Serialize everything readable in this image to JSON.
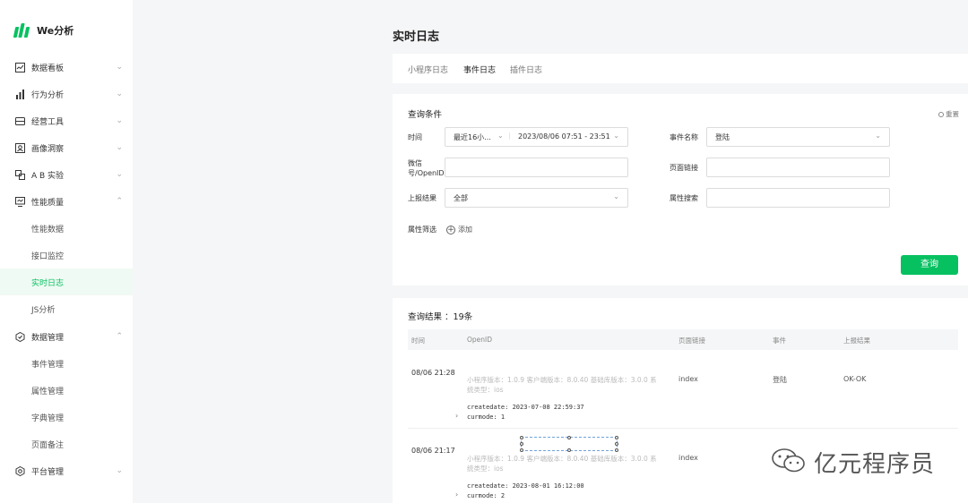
{
  "app": {
    "name": "We分析"
  },
  "sidebar": {
    "items": [
      {
        "label": "数据看板",
        "icon": "chart-line-icon",
        "chevron": "⌄"
      },
      {
        "label": "行为分析",
        "icon": "bar-chart-icon",
        "chevron": "⌄"
      },
      {
        "label": "经营工具",
        "icon": "toolbox-icon",
        "chevron": "⌄"
      },
      {
        "label": "画像洞察",
        "icon": "portrait-icon",
        "chevron": "⌄"
      },
      {
        "label": "A B 实验",
        "icon": "ab-test-icon",
        "chevron": "⌄"
      },
      {
        "label": "性能质量",
        "icon": "monitor-icon",
        "chevron": "⌃"
      },
      {
        "label": "数据管理",
        "icon": "hexagon-check-icon",
        "chevron": "⌃"
      },
      {
        "label": "平台管理",
        "icon": "settings-icon",
        "chevron": "⌄"
      }
    ],
    "perf_sub": [
      "性能数据",
      "接口监控",
      "实时日志",
      "JS分析"
    ],
    "data_sub": [
      "事件管理",
      "属性管理",
      "字典管理",
      "页面备注"
    ]
  },
  "page": {
    "title": "实时日志"
  },
  "tabs": [
    "小程序日志",
    "事件日志",
    "插件日志"
  ],
  "query": {
    "title": "查询条件",
    "reset": "重置",
    "time_label": "时间",
    "time_preset": "最近16小...",
    "time_range": "2023/08/06 07:51 - 23:51",
    "event_label": "事件名称",
    "event_value": "登陆",
    "openid_label": "微信号/OpenID",
    "page_link_label": "页面链接",
    "report_label": "上报结果",
    "report_value": "全部",
    "attr_search_label": "属性搜索",
    "attr_filter_label": "属性筛选",
    "add_label": "添加",
    "submit": "查询"
  },
  "results": {
    "title": "查询结果 ：19条",
    "columns": [
      "时间",
      "OpenID",
      "页面链接",
      "事件",
      "上报结果"
    ],
    "rows": [
      {
        "time": "08/06 21:28",
        "meta": "小程序版本：1.0.9 客户端版本：8.0.40 基础库版本：3.0.0 系统类型：ios",
        "line1": "createdate: 2023-07-08 22:59:37",
        "line2": "curmode: 1",
        "page": "index",
        "event": "登陆",
        "result": "OK-OK"
      },
      {
        "time": "08/06 21:17",
        "meta": "小程序版本：1.0.9 客户端版本：8.0.40 基础库版本：3.0.0 系统类型：ios",
        "line1": "createdate: 2023-08-01 16:12:00",
        "line2": "curmode: 2",
        "page": "index",
        "event": "",
        "result": ""
      }
    ]
  },
  "watermark": {
    "text": "亿元程序员",
    "icon": "wechat-icon"
  },
  "colors": {
    "accent": "#07c160",
    "bg": "#f5f6f7"
  }
}
